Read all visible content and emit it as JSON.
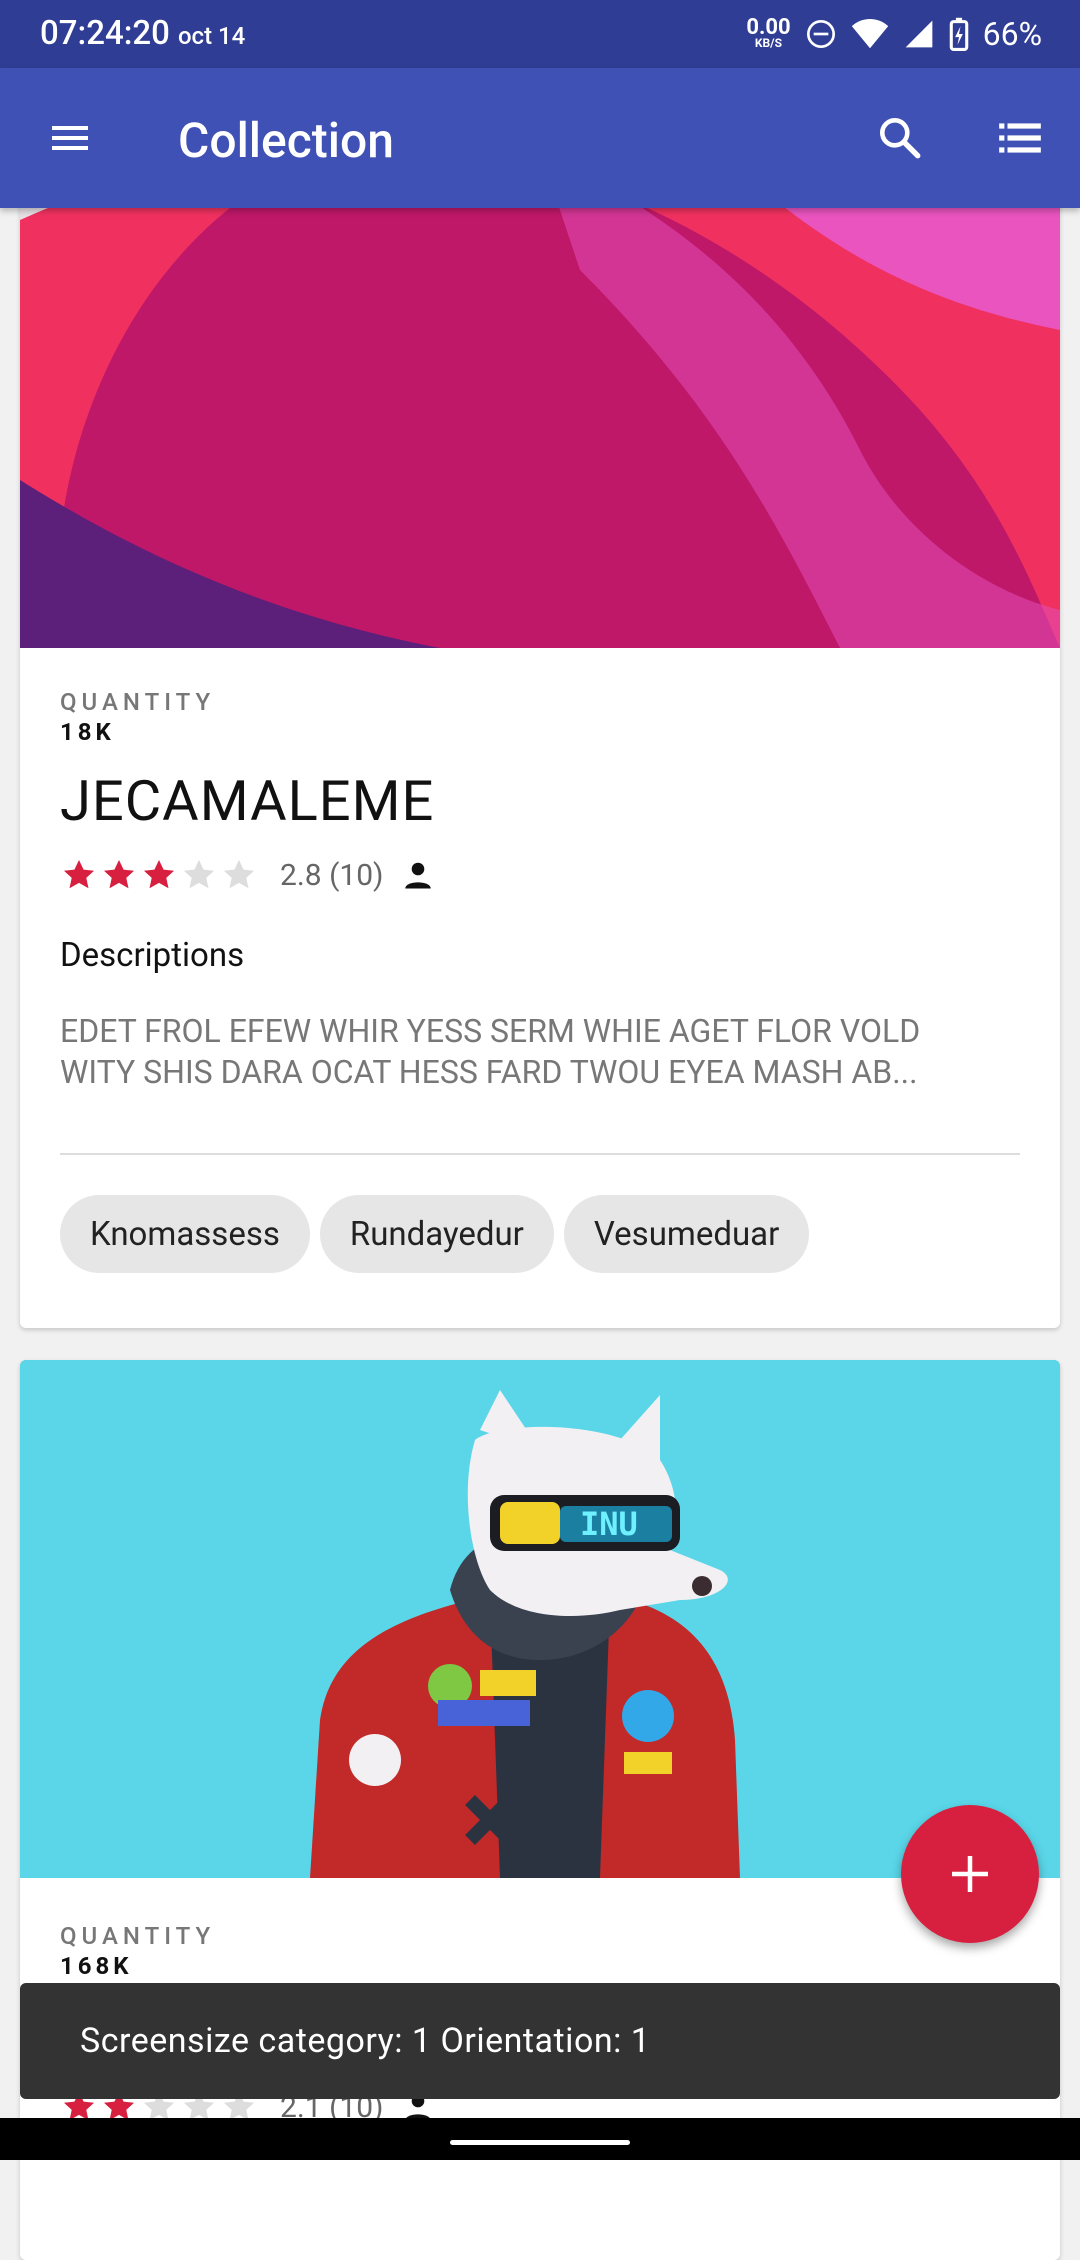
{
  "status_bar": {
    "time": "07:24:20",
    "date": "oct 14",
    "net_speed": "0.00",
    "net_unit": "KB/S",
    "battery": "66%"
  },
  "appbar": {
    "title": "Collection",
    "menu_icon": "hamburger-menu-icon",
    "search_icon": "search-icon",
    "view_icon": "list-view-icon"
  },
  "cards": [
    {
      "quantity_label": "QUANTITY",
      "quantity_value": "18K",
      "title": "JECAMALEME",
      "rating": 2.8,
      "rating_text": "2.8 (10)",
      "filled_stars": 3,
      "total_stars": 5,
      "description_heading": "Descriptions",
      "description_line1": "EDET FROL EFEW WHIR YESS SERM WHIE AGET FLOR VOLD",
      "description_line2": "WITY SHIS DARA OCAT HESS FARD TWOU EYEA MASH AB...",
      "chips": [
        "Knomassess",
        "Rundayedur",
        "Vesumeduar"
      ]
    },
    {
      "quantity_label": "QUANTITY",
      "quantity_value": "168K",
      "rating_text": "2.1 (10)",
      "filled_stars": 2,
      "total_stars": 5
    }
  ],
  "fab": {
    "icon": "plus-icon"
  },
  "snackbar": {
    "text": "Screensize category: 1 Orientation: 1"
  },
  "colors": {
    "status_bar": "#2f3d95",
    "appbar": "#3f51b5",
    "accent": "#d7203f",
    "star_filled": "#d7203f",
    "star_empty": "#dddddd"
  }
}
